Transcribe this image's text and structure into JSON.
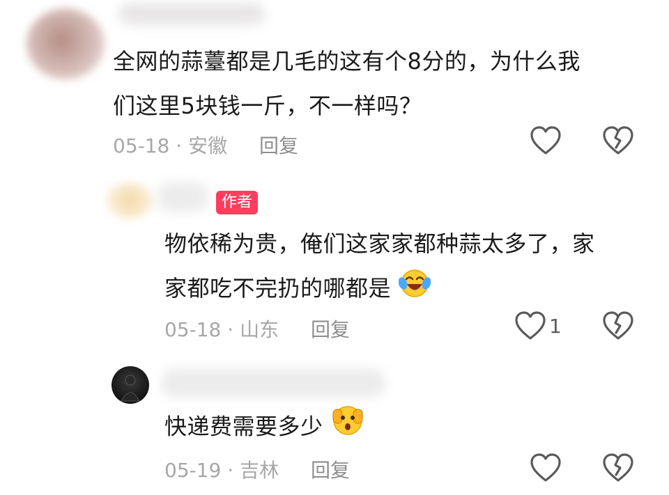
{
  "comments": [
    {
      "text_line1": "全网的蒜薹都是几毛的这有个8分的，为什么我",
      "text_line2": "们这里5块钱一斤，不一样吗？",
      "date": "05-18",
      "location": "安徽",
      "reply_label": "回复"
    },
    {
      "author_badge": "作者",
      "text_line1": "物依稀为贵，俺们这家家都种蒜太多了，家",
      "text_line2": "家都吃不完扔的哪都是",
      "emoji": "laughing-crying-emoji",
      "date": "05-18",
      "location": "山东",
      "reply_label": "回复",
      "like_count": "1"
    },
    {
      "text_line1": "快递费需要多少",
      "emoji": "shocked-face-emoji",
      "date": "05-19",
      "location": "吉林",
      "reply_label": "回复"
    }
  ],
  "icons": {
    "like": "heart-outline-icon",
    "dislike": "broken-heart-icon"
  },
  "colors": {
    "badge": "#ff3d5f",
    "meta_text": "#a7a7a7",
    "icon_stroke": "#5a5a5a"
  }
}
